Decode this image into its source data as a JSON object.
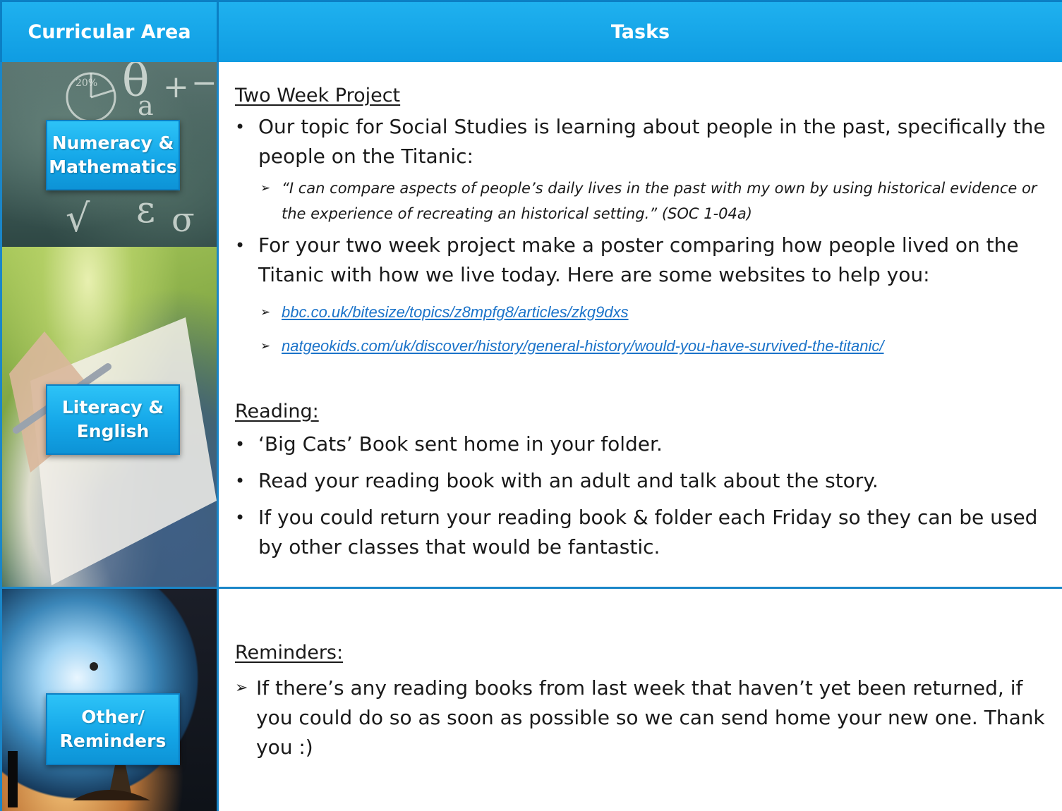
{
  "header": {
    "left_title": "Curricular Area",
    "right_title": "Tasks"
  },
  "left_column": {
    "math_label": "Numeracy & Mathematics",
    "literacy_label": "Literacy & English",
    "other_label": "Other/ Reminders",
    "chalk_glyphs": [
      "θ",
      "+",
      "−",
      "a",
      "√",
      "ε",
      "σ",
      "20%"
    ]
  },
  "project": {
    "heading": "Two Week Project",
    "bullet1": "Our topic for Social Studies is learning about people in the past, specifically the people on the Titanic:",
    "quote": "“I can compare aspects of people’s daily lives in the past with my own by using historical evidence or the experience of recreating an historical setting.” (SOC 1-04a)",
    "bullet2": "For your two week project make a poster comparing how people lived on the Titanic with how we live today. Here are some websites to help you:",
    "link1": "bbc.co.uk/bitesize/topics/z8mpfg8/articles/zkg9dxs",
    "link2": "natgeokids.com/uk/discover/history/general-history/would-you-have-survived-the-titanic/"
  },
  "reading": {
    "heading": "Reading:",
    "items": [
      "‘Big Cats’ Book sent home in your folder.",
      "Read your reading book with an adult and talk about the story.",
      "If you could return your reading book & folder each Friday so they can be used by other classes that would be fantastic."
    ]
  },
  "reminders": {
    "heading": "Reminders:",
    "item": "If there’s any reading books from last week that haven’t yet been returned, if you could do so as soon as possible so we can send home your new one. Thank you :)"
  },
  "colors": {
    "header_blue": "#1fb1ef",
    "border_blue": "#1a86c8",
    "link_blue": "#1b73c9"
  }
}
